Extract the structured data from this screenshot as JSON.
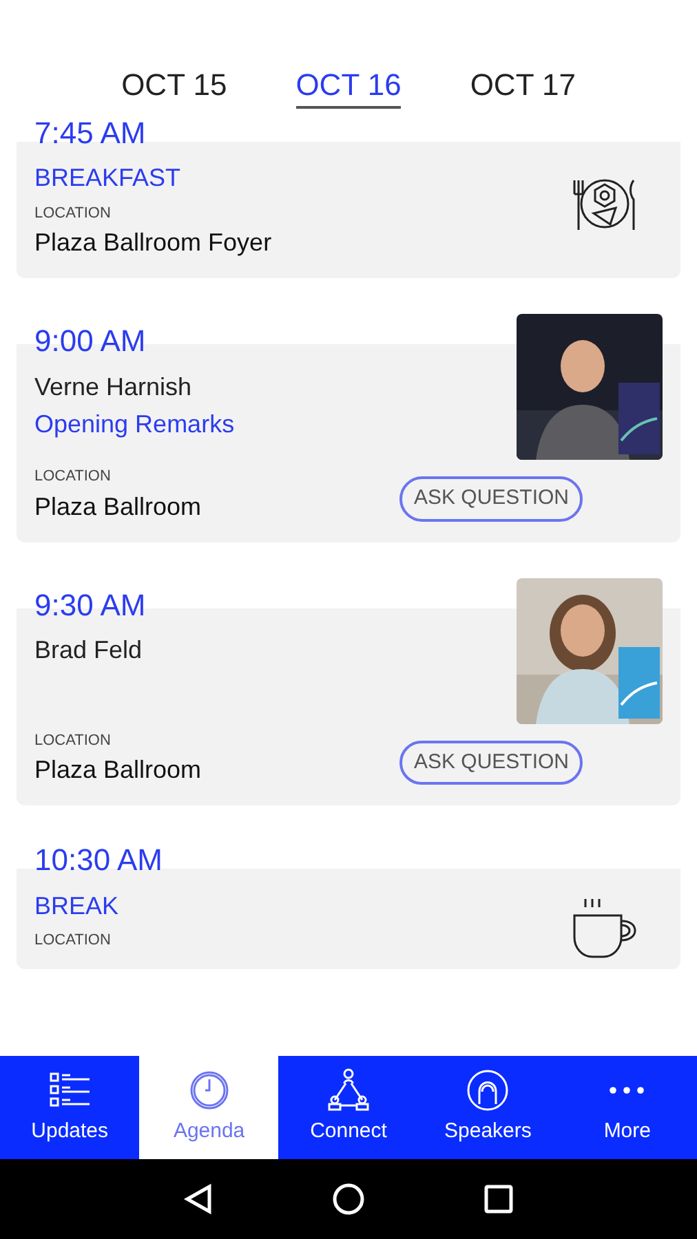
{
  "date_tabs": [
    {
      "label": "OCT 15",
      "selected": false
    },
    {
      "label": "OCT 16",
      "selected": true
    },
    {
      "label": "OCT 17",
      "selected": false
    }
  ],
  "sessions": [
    {
      "kind": "meal",
      "time": "7:45 AM",
      "title": "BREAKFAST",
      "location_label": "LOCATION",
      "location": "Plaza Ballroom Foyer"
    },
    {
      "kind": "talk",
      "time": "9:00 AM",
      "speaker": "Verne Harnish",
      "title": "Opening Remarks",
      "location_label": "LOCATION",
      "location": "Plaza Ballroom",
      "button": "ASK QUESTION"
    },
    {
      "kind": "talk",
      "time": "9:30 AM",
      "speaker": "Brad Feld",
      "location_label": "LOCATION",
      "location": "Plaza Ballroom",
      "button": "ASK QUESTION"
    },
    {
      "kind": "break",
      "time": "10:30 AM",
      "title": "BREAK",
      "location_label": "LOCATION"
    }
  ],
  "nav": [
    {
      "label": "Updates",
      "selected": false
    },
    {
      "label": "Agenda",
      "selected": true
    },
    {
      "label": "Connect",
      "selected": false
    },
    {
      "label": "Speakers",
      "selected": false
    },
    {
      "label": "More",
      "selected": false
    }
  ]
}
